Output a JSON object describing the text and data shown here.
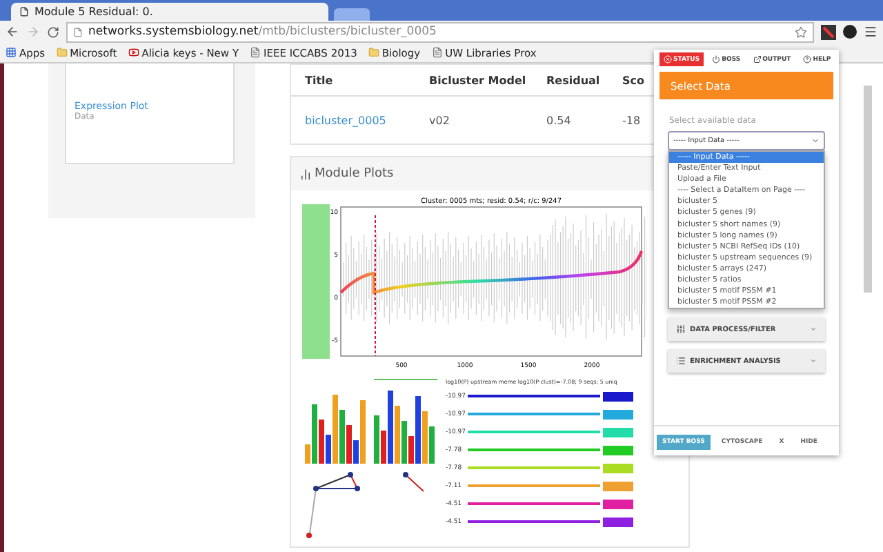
{
  "browser": {
    "tab_title": "Module 5 Residual: 0.",
    "url_host": "networks.systemsbiology.net",
    "url_path": "/mtb/biclusters/bicluster_0005",
    "bookmarks": [
      {
        "label": "Apps",
        "kind": "apps"
      },
      {
        "label": "Microsoft",
        "kind": "folder"
      },
      {
        "label": "Alicia keys - New Y",
        "kind": "video"
      },
      {
        "label": "IEEE ICCABS 2013",
        "kind": "page"
      },
      {
        "label": "Biology",
        "kind": "folder"
      },
      {
        "label": "UW Libraries Prox",
        "kind": "page"
      }
    ]
  },
  "sidebar": {
    "title": "Expression Plot",
    "subtitle": "Data"
  },
  "table": {
    "columns": [
      "Title",
      "Bicluster Model",
      "Residual",
      "Sco"
    ],
    "rows": [
      [
        "bicluster_0005",
        "v02",
        "0.54",
        "-18"
      ]
    ]
  },
  "module_plots": {
    "title": "Module Plots",
    "plot_title": "Cluster: 0005 mts; resid: 0.54; r/c: 9/247",
    "yticks": [
      "10",
      "5",
      "0",
      "-5"
    ],
    "xticks": [
      "500",
      "1000",
      "1500",
      "2000"
    ],
    "motif_header": "log10(P) upstream meme   log10(P-clust)=-7.08; 9 seqs; 5 uniq",
    "motif_rows": [
      {
        "score": "-10.97",
        "color": "#1a1acc"
      },
      {
        "score": "-10.97",
        "color": "#22aadd"
      },
      {
        "score": "-10.97",
        "color": "#22ddaa"
      },
      {
        "score": "-7.78",
        "color": "#22cc22"
      },
      {
        "score": "-7.78",
        "color": "#aadd22"
      },
      {
        "score": "-7.11",
        "color": "#f0a030"
      },
      {
        "score": "-4.51",
        "color": "#e020a0"
      },
      {
        "score": "-4.51",
        "color": "#9020e0"
      }
    ]
  },
  "popup": {
    "tabs": [
      {
        "label": "STATUS",
        "selected": true
      },
      {
        "label": "BOSS",
        "selected": false
      },
      {
        "label": "OUTPUT",
        "selected": false
      },
      {
        "label": "HELP",
        "selected": false
      }
    ],
    "header": "Select Data",
    "field_label": "Select available data",
    "select_value": "----- Input Data -----",
    "options": [
      {
        "label": "----- Input Data -----",
        "selected": true
      },
      {
        "label": "Paste/Enter Text Input",
        "selected": false
      },
      {
        "label": "Upload a File",
        "selected": false
      },
      {
        "label": "---- Select a DataItem on Page ----",
        "selected": false
      },
      {
        "label": "bicluster 5",
        "selected": false
      },
      {
        "label": "bicluster 5 genes (9)",
        "selected": false
      },
      {
        "label": "bicluster 5 short names (9)",
        "selected": false
      },
      {
        "label": "bicluster 5 long names (9)",
        "selected": false
      },
      {
        "label": "bicluster 5 NCBI RefSeq IDs (10)",
        "selected": false
      },
      {
        "label": "bicluster 5 upstream sequences (9)",
        "selected": false
      },
      {
        "label": "bicluster 5 arrays (247)",
        "selected": false
      },
      {
        "label": "bicluster 5 ratios",
        "selected": false
      },
      {
        "label": "bicluster 5 motif PSSM #1",
        "selected": false
      },
      {
        "label": "bicluster 5 motif PSSM #2",
        "selected": false
      }
    ],
    "sections": [
      {
        "label": "DATA PROCESS/FILTER",
        "kind": "filter"
      },
      {
        "label": "ENRICHMENT ANALYSIS",
        "kind": "list"
      }
    ],
    "footer": [
      {
        "label": "START BOSS",
        "kind": "primary"
      },
      {
        "label": "CYTOSCAPE",
        "kind": "plain"
      },
      {
        "label": "X",
        "kind": "plain"
      },
      {
        "label": "HIDE",
        "kind": "plain"
      }
    ]
  }
}
